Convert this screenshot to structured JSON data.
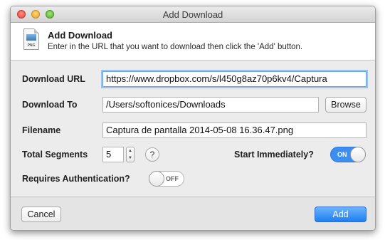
{
  "window": {
    "title": "Add Download"
  },
  "header": {
    "title": "Add Download",
    "subtitle": "Enter in the URL that you want to download then click the 'Add' button.",
    "icon_label": "PNG"
  },
  "form": {
    "url_label": "Download URL",
    "url_value": "https://www.dropbox.com/s/l450g8az70p6kv4/Captura",
    "dest_label": "Download To",
    "dest_value": "/Users/softonices/Downloads",
    "browse_label": "Browse",
    "filename_label": "Filename",
    "filename_value": "Captura de pantalla 2014-05-08 16.36.47.png",
    "segments_label": "Total Segments",
    "segments_value": "5",
    "help_label": "?",
    "start_label": "Start Immediately?",
    "start_state": "ON",
    "auth_label": "Requires Authentication?",
    "auth_state": "OFF"
  },
  "footer": {
    "cancel_label": "Cancel",
    "add_label": "Add"
  },
  "colors": {
    "accent": "#1e7ef2",
    "toggle_on": "#3d8ef1",
    "focus_ring": "#9dc3ec"
  }
}
